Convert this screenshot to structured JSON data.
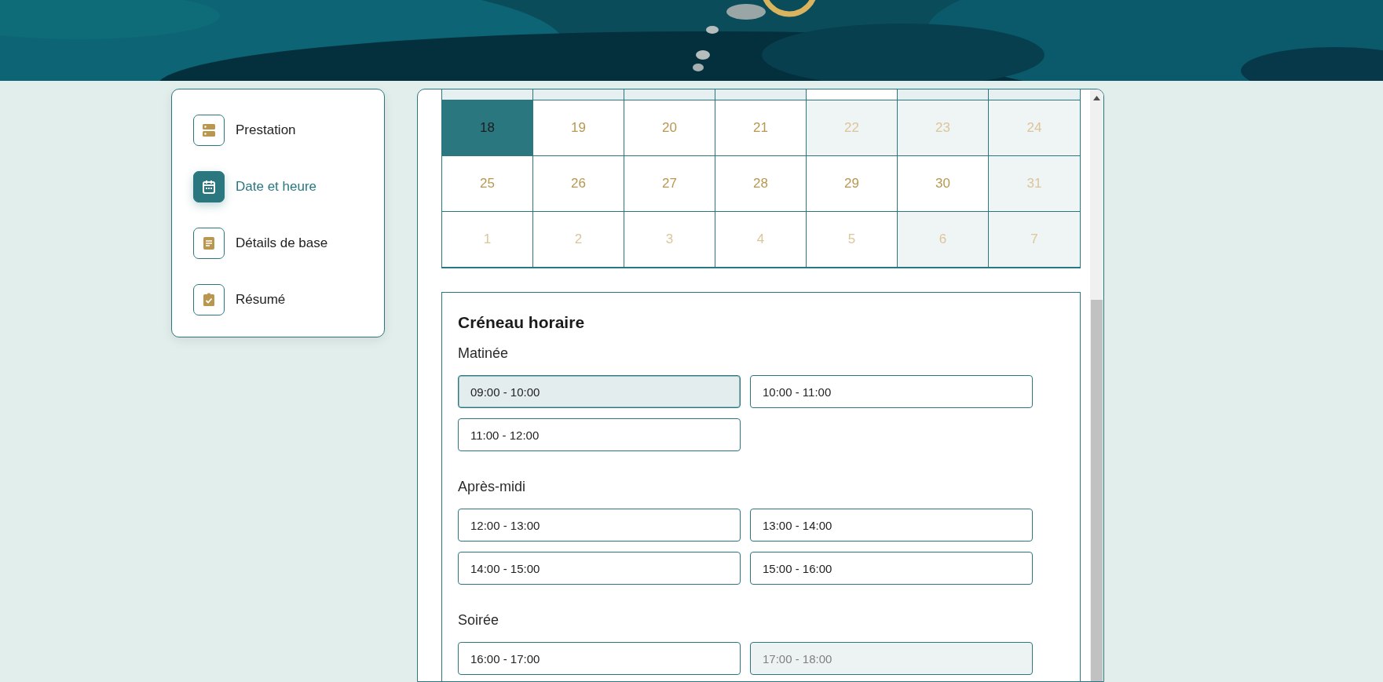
{
  "steps": [
    {
      "label": "Prestation",
      "kind": "service",
      "selected": false
    },
    {
      "label": "Date et heure",
      "kind": "calendar",
      "selected": true
    },
    {
      "label": "Détails de base",
      "kind": "details",
      "selected": false
    },
    {
      "label": "Résumé",
      "kind": "summary",
      "selected": false
    }
  ],
  "calendar": {
    "partial_row": [
      {
        "shaded": true
      },
      {
        "shaded": true
      },
      {
        "shaded": true
      },
      {
        "shaded": true
      },
      {
        "shaded": false
      },
      {
        "shaded": true
      },
      {
        "shaded": true
      }
    ],
    "weeks": [
      [
        {
          "day": "18",
          "selected": true,
          "shaded": false,
          "dimmed": false
        },
        {
          "day": "19",
          "selected": false,
          "shaded": false,
          "dimmed": false
        },
        {
          "day": "20",
          "selected": false,
          "shaded": false,
          "dimmed": false
        },
        {
          "day": "21",
          "selected": false,
          "shaded": false,
          "dimmed": false
        },
        {
          "day": "22",
          "selected": false,
          "shaded": true,
          "dimmed": true
        },
        {
          "day": "23",
          "selected": false,
          "shaded": true,
          "dimmed": true
        },
        {
          "day": "24",
          "selected": false,
          "shaded": true,
          "dimmed": true
        }
      ],
      [
        {
          "day": "25",
          "selected": false,
          "shaded": false,
          "dimmed": false
        },
        {
          "day": "26",
          "selected": false,
          "shaded": false,
          "dimmed": false
        },
        {
          "day": "27",
          "selected": false,
          "shaded": false,
          "dimmed": false
        },
        {
          "day": "28",
          "selected": false,
          "shaded": false,
          "dimmed": false
        },
        {
          "day": "29",
          "selected": false,
          "shaded": false,
          "dimmed": false
        },
        {
          "day": "30",
          "selected": false,
          "shaded": false,
          "dimmed": false
        },
        {
          "day": "31",
          "selected": false,
          "shaded": true,
          "dimmed": true
        }
      ],
      [
        {
          "day": "1",
          "selected": false,
          "shaded": false,
          "dimmed": true
        },
        {
          "day": "2",
          "selected": false,
          "shaded": false,
          "dimmed": true
        },
        {
          "day": "3",
          "selected": false,
          "shaded": false,
          "dimmed": true
        },
        {
          "day": "4",
          "selected": false,
          "shaded": false,
          "dimmed": true
        },
        {
          "day": "5",
          "selected": false,
          "shaded": false,
          "dimmed": true
        },
        {
          "day": "6",
          "selected": false,
          "shaded": true,
          "dimmed": true
        },
        {
          "day": "7",
          "selected": false,
          "shaded": true,
          "dimmed": true
        }
      ]
    ]
  },
  "time_slots": {
    "title": "Créneau horaire",
    "groups": [
      {
        "label": "Matinée",
        "slots": [
          {
            "label": "09:00 - 10:00",
            "selected": true,
            "disabled": false
          },
          {
            "label": "10:00 - 11:00",
            "selected": false,
            "disabled": false
          },
          {
            "label": "11:00 - 12:00",
            "selected": false,
            "disabled": false
          }
        ]
      },
      {
        "label": "Après-midi",
        "slots": [
          {
            "label": "12:00 - 13:00",
            "selected": false,
            "disabled": false
          },
          {
            "label": "13:00 - 14:00",
            "selected": false,
            "disabled": false
          },
          {
            "label": "14:00 - 15:00",
            "selected": false,
            "disabled": false
          },
          {
            "label": "15:00 - 16:00",
            "selected": false,
            "disabled": false
          }
        ]
      },
      {
        "label": "Soirée",
        "slots": [
          {
            "label": "16:00 - 17:00",
            "selected": false,
            "disabled": false
          },
          {
            "label": "17:00 - 18:00",
            "selected": false,
            "disabled": true
          }
        ]
      }
    ]
  }
}
